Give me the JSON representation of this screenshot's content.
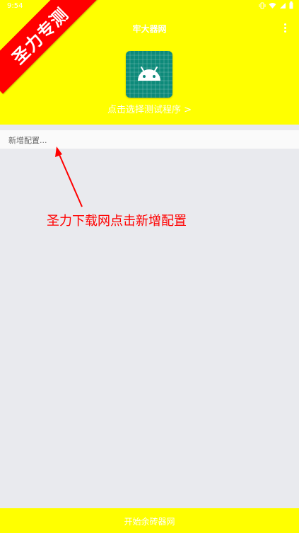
{
  "status_bar": {
    "time": "9:54",
    "icons": [
      "vibrate-icon",
      "wifi-icon",
      "signal-icon",
      "battery-icon"
    ]
  },
  "header": {
    "title": "牢大器网",
    "menu_icon": "more-vert-icon",
    "app_icon": "android-icon",
    "select_link": "点击选择测试程序 >"
  },
  "ribbon": {
    "text": "圣力专测"
  },
  "config": {
    "placeholder": "新增配置..."
  },
  "annotation": {
    "text": "圣力下载网点击新增配置"
  },
  "bottom": {
    "button_label": "开始余砖器网"
  },
  "colors": {
    "accent": "#ffff00",
    "background": "#e9eaee",
    "ribbon": "#ff0000",
    "annotation": "#ff0000",
    "app_icon_bg": "#0d8a7a"
  }
}
